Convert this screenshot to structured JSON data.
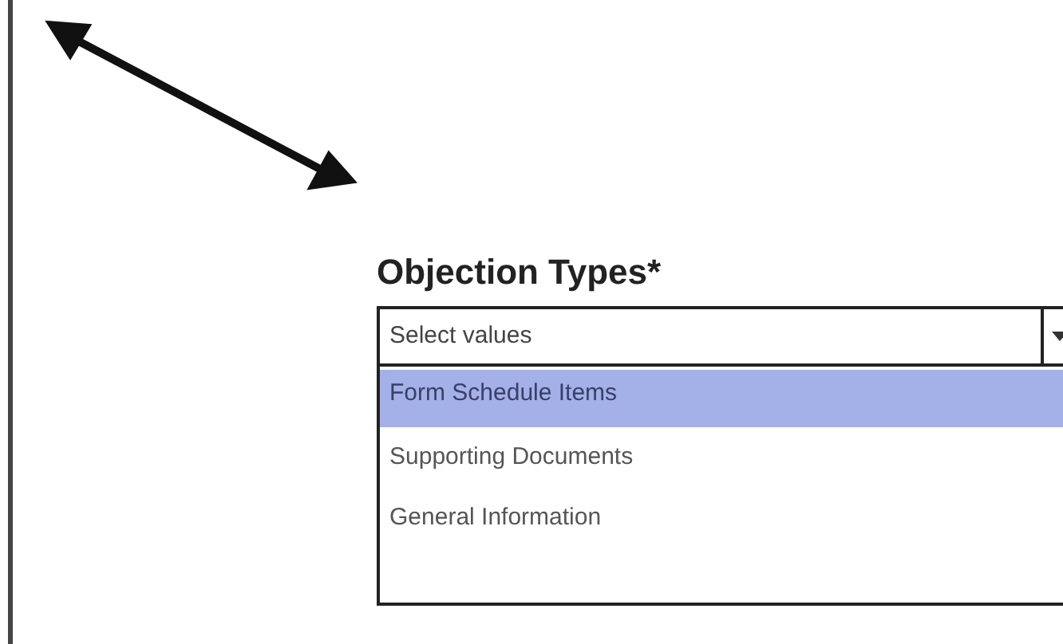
{
  "field": {
    "label": "Objection Types*",
    "placeholder": "Select values",
    "expanded": true
  },
  "options": [
    {
      "label": "Form Schedule Items",
      "selected": true
    },
    {
      "label": "Supporting Documents",
      "selected": false
    },
    {
      "label": "General Information",
      "selected": false
    }
  ]
}
